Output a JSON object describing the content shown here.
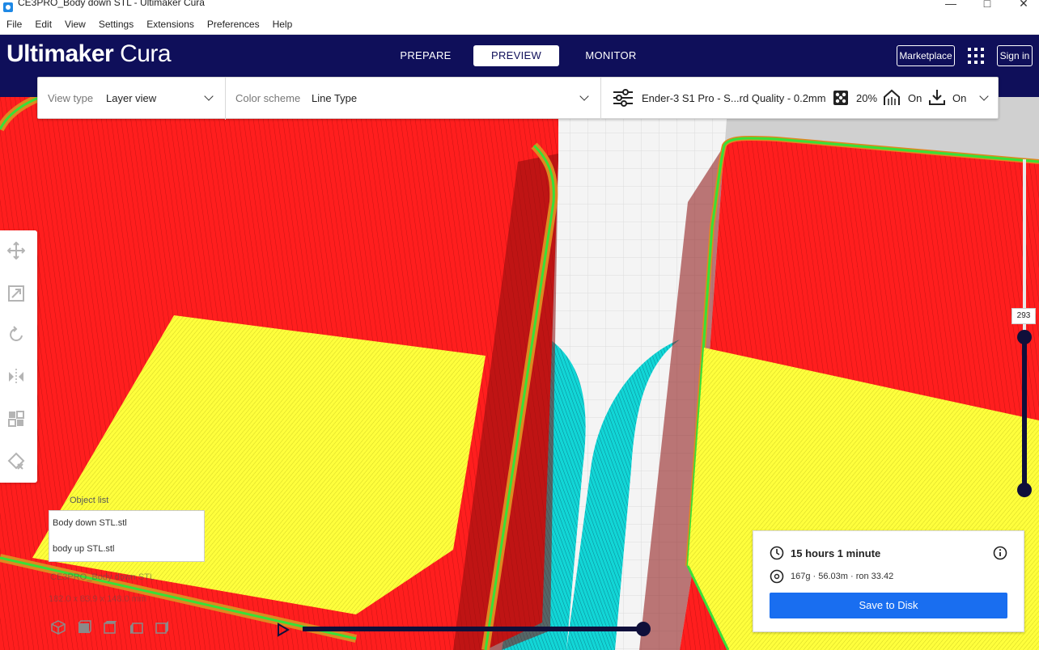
{
  "window": {
    "title": "CE3PRO_Body down STL - Ultimaker Cura"
  },
  "menu": [
    "File",
    "Edit",
    "View",
    "Settings",
    "Extensions",
    "Preferences",
    "Help"
  ],
  "header": {
    "logo_bold": "Ultimaker",
    "logo_light": "Cura",
    "tabs": [
      "PREPARE",
      "PREVIEW",
      "MONITOR"
    ],
    "active_tab": "PREVIEW",
    "marketplace": "Marketplace",
    "signin": "Sign in"
  },
  "settings_bar": {
    "view_type_label": "View type",
    "view_type_value": "Layer view",
    "color_scheme_label": "Color scheme",
    "color_scheme_value": "Line Type",
    "profile": "Ender-3 S1 Pro - S...rd Quality - 0.2mm",
    "infill": "20%",
    "support": "On",
    "adhesion": "On"
  },
  "object_list": {
    "label": "Object list",
    "items": [
      "Body down STL.stl",
      "body up STL.stl"
    ],
    "build_name": "CE3PRO_Body down STL",
    "build_size": "182.0 x 83.9 x 148.0 mm"
  },
  "print_info": {
    "time": "15 hours 1 minute",
    "material": "167g · 56.03m · ron 33.42",
    "save": "Save to Disk"
  },
  "layer": {
    "current": "293"
  },
  "colors": {
    "header": "#0f0f5a",
    "wall_outer": "#ff1e1e",
    "skin": "#ffff3c",
    "wall_inner": "#38e038",
    "support": "#00d0d0",
    "accent": "#196ef0"
  },
  "icons": [
    "move-icon",
    "scale-icon",
    "rotate-icon",
    "mirror-icon",
    "per-model-settings-icon",
    "support-blocker-icon",
    "infill-icon",
    "support-icon",
    "adhesion-icon",
    "clock-icon",
    "info-icon",
    "spool-icon",
    "settings-sliders-icon",
    "apps-grid-icon"
  ]
}
